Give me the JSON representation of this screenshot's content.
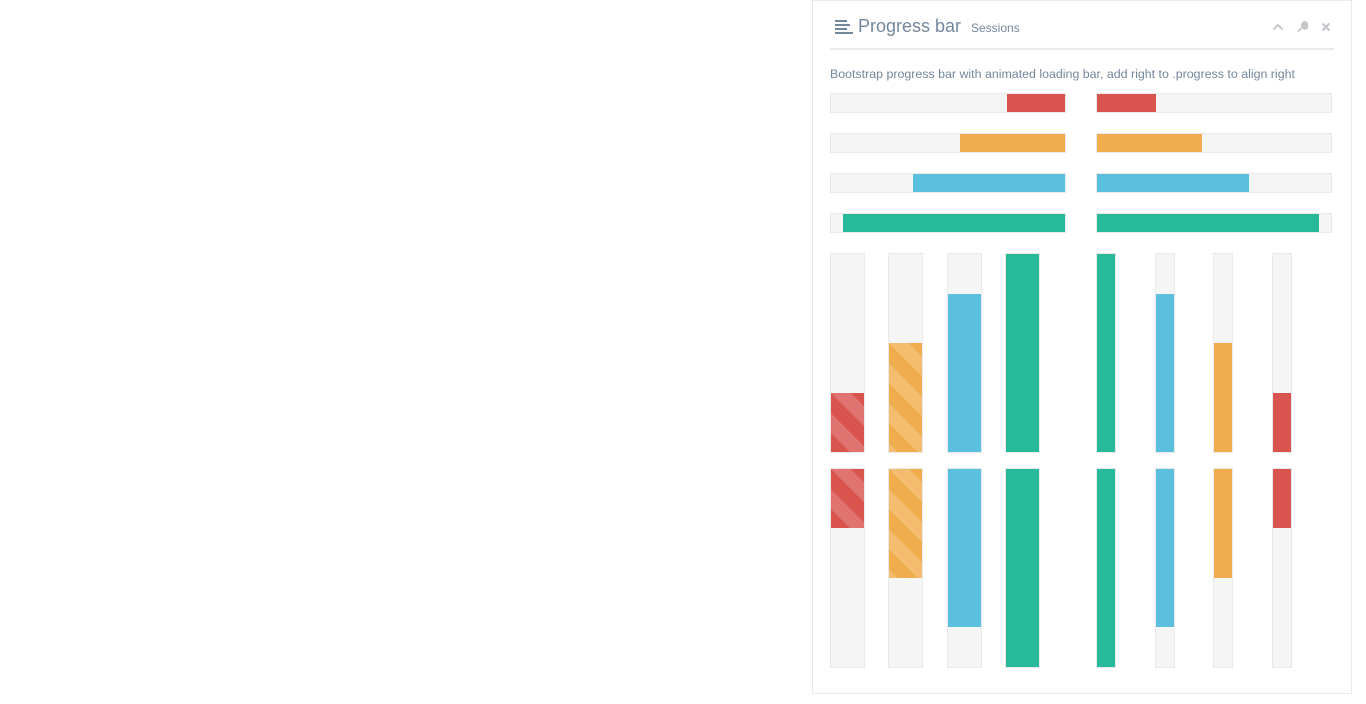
{
  "panel": {
    "title": "Progress bar",
    "subtitle": "Sessions",
    "description": "Bootstrap progress bar with animated loading bar, add right to .progress to align right",
    "tools": [
      "chevron-up-icon",
      "wrench-icon",
      "close-icon"
    ]
  },
  "colors": {
    "danger": "#D9534F",
    "warning": "#F0AD4E",
    "info": "#5BC0DE",
    "success": "#26B99A",
    "track": "#F5F5F5"
  },
  "horizontal_bars": [
    {
      "color": "danger",
      "right_aligned_value": 25,
      "left_aligned_value": 25
    },
    {
      "color": "warning",
      "right_aligned_value": 45,
      "left_aligned_value": 45
    },
    {
      "color": "info",
      "right_aligned_value": 65,
      "left_aligned_value": 65
    },
    {
      "color": "success",
      "right_aligned_value": 95,
      "left_aligned_value": 95
    }
  ],
  "vertical_bars": [
    {
      "color": "danger",
      "value": 12,
      "striped": true
    },
    {
      "color": "warning",
      "value": 22,
      "striped": true
    },
    {
      "color": "info",
      "value": 32,
      "striped": false
    },
    {
      "color": "success",
      "value": 42,
      "striped": false
    },
    {
      "color": "success",
      "value": 42,
      "striped": false
    },
    {
      "color": "info",
      "value": 32,
      "striped": false
    },
    {
      "color": "warning",
      "value": 22,
      "striped": false
    },
    {
      "color": "danger",
      "value": 12,
      "striped": false
    }
  ]
}
